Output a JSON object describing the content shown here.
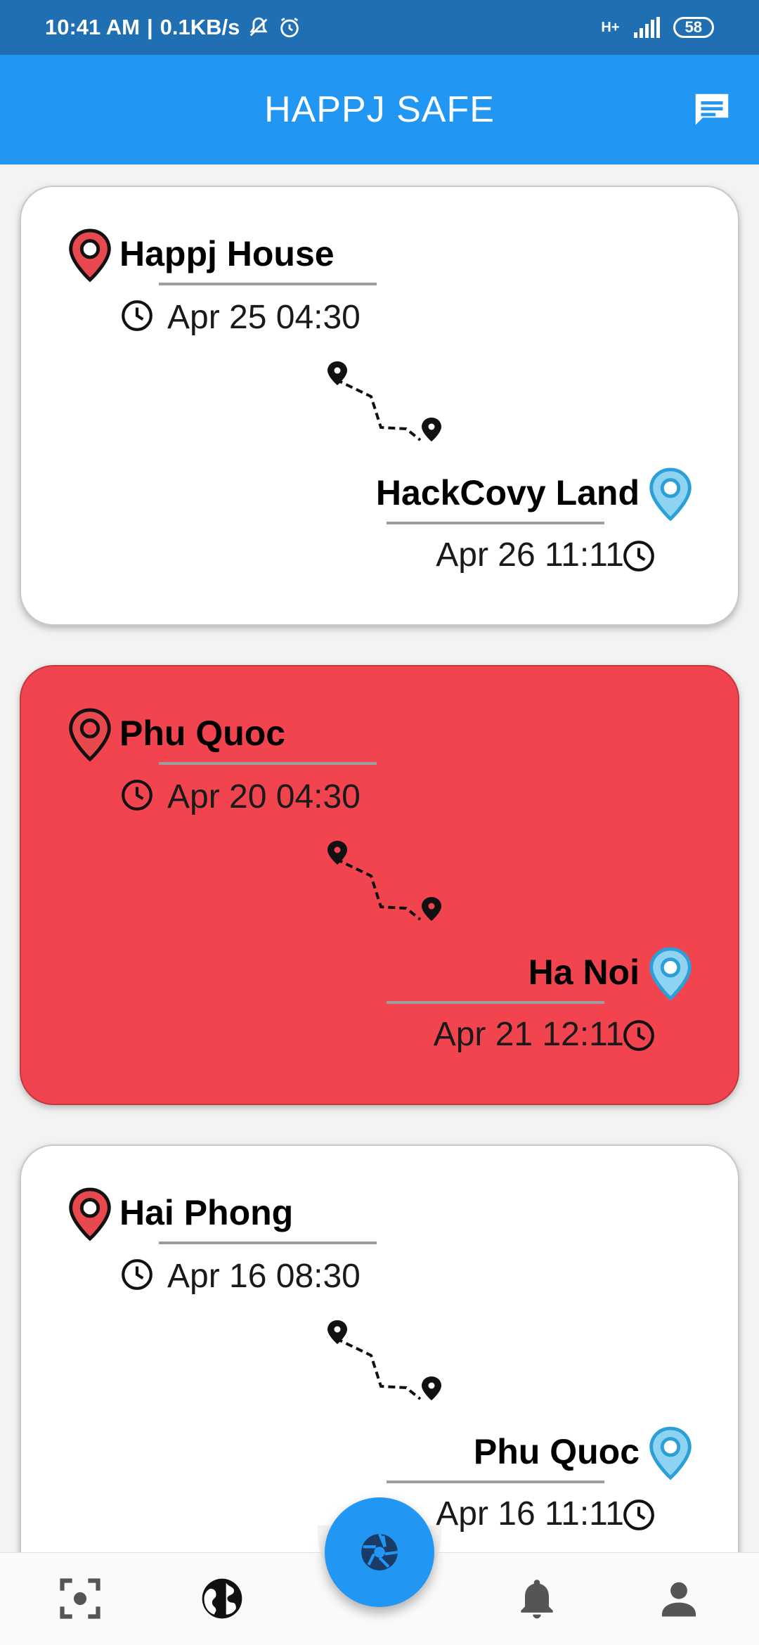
{
  "status_bar": {
    "time": "10:41 AM",
    "separator": "|",
    "speed": "0.1KB/s",
    "network": "H+",
    "battery": "58"
  },
  "app_bar": {
    "title": "HAPPJ SAFE",
    "action_icon": "message-icon"
  },
  "trips": [
    {
      "origin": "Happj House",
      "origin_time": "Apr 25 04:30",
      "destination": "HackCovy Land",
      "destination_time": "Apr 26 11:11",
      "highlighted": false
    },
    {
      "origin": "Phu Quoc",
      "origin_time": "Apr 20 04:30",
      "destination": "Ha Noi",
      "destination_time": "Apr 21 12:11",
      "highlighted": true
    },
    {
      "origin": "Hai Phong",
      "origin_time": "Apr 16 08:30",
      "destination": "Phu Quoc",
      "destination_time": "Apr 16 11:11",
      "highlighted": false
    }
  ],
  "bottom_nav": {
    "items": [
      "scan-icon",
      "globe-icon",
      "bell-icon",
      "profile-icon"
    ],
    "fab_icon": "camera-shutter-icon",
    "active": "globe-icon"
  },
  "colors": {
    "primary": "#2196f3",
    "status_bar": "#1f6fb2",
    "highlight_card": "#f1444e",
    "origin_pin": "#e8494f",
    "destination_pin": "#8fd3f2"
  }
}
